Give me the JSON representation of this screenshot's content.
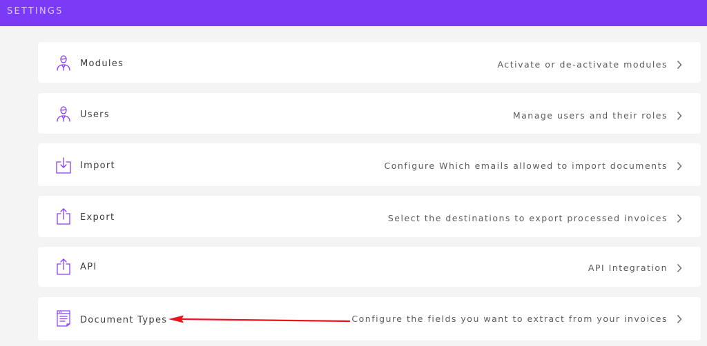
{
  "header": {
    "title": "SETTINGS"
  },
  "items": [
    {
      "label": "Modules",
      "description": "Activate or de-activate modules",
      "icon": "person-icon"
    },
    {
      "label": "Users",
      "description": "Manage users and their roles",
      "icon": "person-icon"
    },
    {
      "label": "Import",
      "description": "Configure Which emails allowed to import documents",
      "icon": "import-icon"
    },
    {
      "label": "Export",
      "description": "Select the destinations to export processed invoices",
      "icon": "export-icon"
    },
    {
      "label": "API",
      "description": "API Integration",
      "icon": "export-icon"
    },
    {
      "label": "Document Types",
      "description": "Configure the fields you want to extract from your invoices",
      "icon": "document-icon"
    }
  ],
  "colors": {
    "header_bg": "#7b3bf6",
    "icon": "#8a3df0",
    "annotation_arrow": "#e8141e",
    "page_bg": "#f4f4f5"
  }
}
